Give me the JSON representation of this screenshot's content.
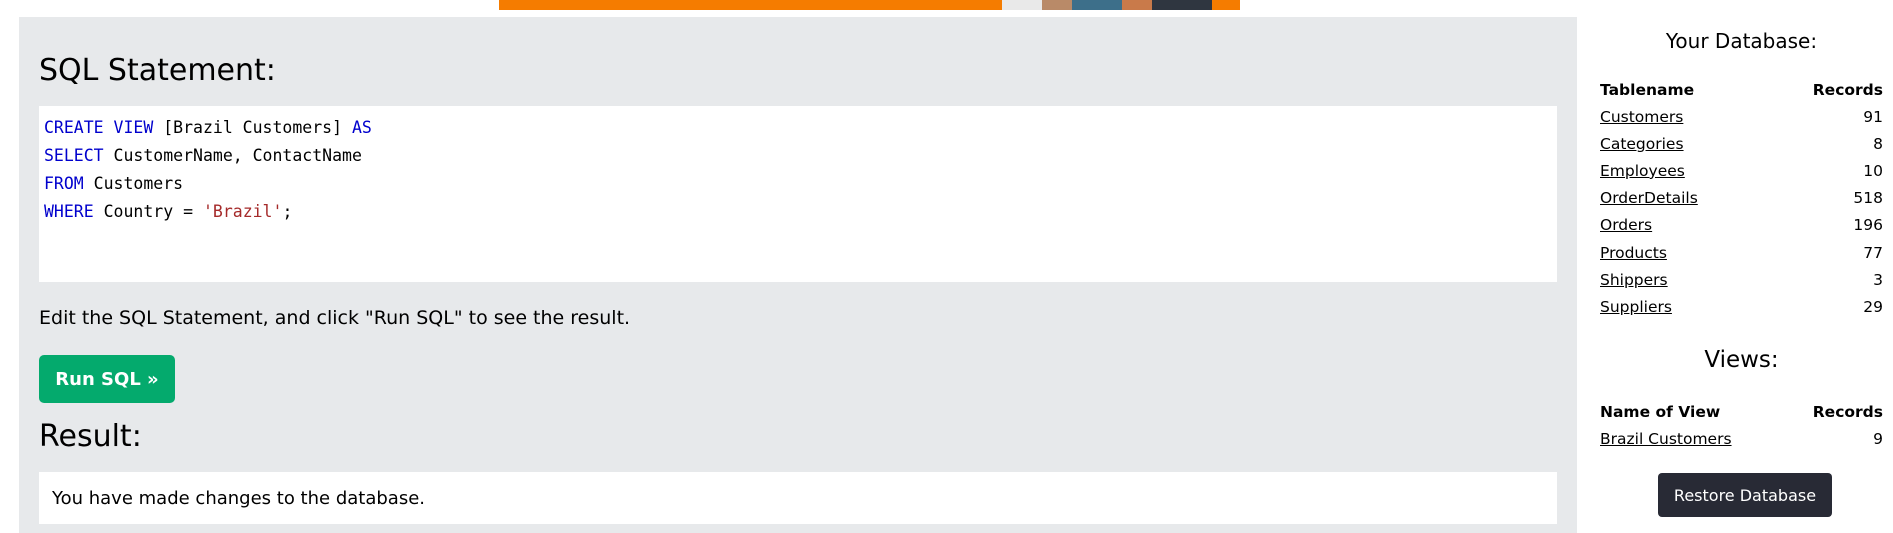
{
  "sql_section": {
    "heading": "SQL Statement:",
    "code_lines": [
      [
        {
          "t": "CREATE VIEW",
          "k": "kw"
        },
        {
          "t": " [Brazil Customers] ",
          "k": ""
        },
        {
          "t": "AS",
          "k": "kw"
        }
      ],
      [
        {
          "t": "SELECT",
          "k": "kw"
        },
        {
          "t": " CustomerName, ContactName",
          "k": ""
        }
      ],
      [
        {
          "t": "FROM",
          "k": "kw"
        },
        {
          "t": " Customers",
          "k": ""
        }
      ],
      [
        {
          "t": "WHERE",
          "k": "kw"
        },
        {
          "t": " Country = ",
          "k": ""
        },
        {
          "t": "'Brazil'",
          "k": "str"
        },
        {
          "t": ";",
          "k": ""
        }
      ]
    ],
    "hint": "Edit the SQL Statement, and click \"Run SQL\" to see the result.",
    "run_label": "Run SQL »"
  },
  "result": {
    "heading": "Result:",
    "message": "You have made changes to the database."
  },
  "database": {
    "title": "Your Database:",
    "col_name": "Tablename",
    "col_records": "Records",
    "tables": [
      {
        "name": "Customers",
        "records": "91"
      },
      {
        "name": "Categories",
        "records": "8"
      },
      {
        "name": "Employees",
        "records": "10"
      },
      {
        "name": "OrderDetails",
        "records": "518"
      },
      {
        "name": "Orders",
        "records": "196"
      },
      {
        "name": "Products",
        "records": "77"
      },
      {
        "name": "Shippers",
        "records": "3"
      },
      {
        "name": "Suppliers",
        "records": "29"
      }
    ]
  },
  "views": {
    "title": "Views:",
    "col_name": "Name of View",
    "col_records": "Records",
    "items": [
      {
        "name": "Brazil Customers",
        "records": "9"
      }
    ]
  },
  "restore_label": "Restore Database",
  "colors": {
    "run_button": "#04aa6d",
    "restore_button": "#282a35",
    "panel_bg": "#e7e9eb",
    "keyword": "#0000cd",
    "string": "#a52a2a",
    "ad_banner": "#f57c00"
  }
}
